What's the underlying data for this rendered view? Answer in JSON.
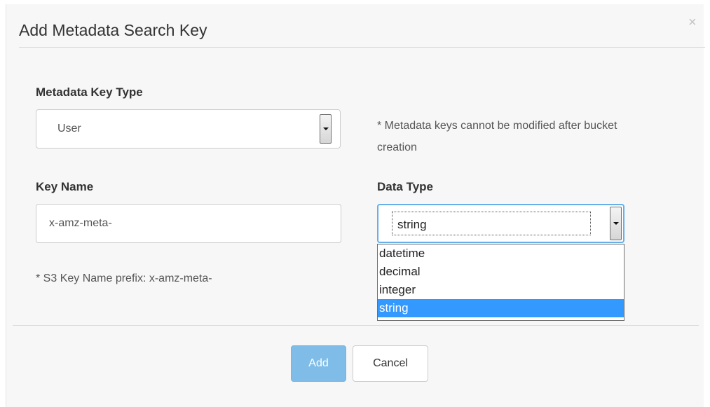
{
  "dialog": {
    "title": "Add Metadata Search Key",
    "close_symbol": "×"
  },
  "metadata_key_type": {
    "label": "Metadata Key Type",
    "selected": "User",
    "note": "* Metadata keys cannot be modified after bucket creation"
  },
  "key_name": {
    "label": "Key Name",
    "value": "x-amz-meta-",
    "prefix_note": "* S3 Key Name prefix: x-amz-meta-"
  },
  "data_type": {
    "label": "Data Type",
    "selected": "string",
    "options": [
      "datetime",
      "decimal",
      "integer",
      "string"
    ],
    "highlighted_option": "string",
    "focus_color": "#66afe9",
    "highlight_color": "#3399ff"
  },
  "footer": {
    "add_label": "Add",
    "cancel_label": "Cancel"
  }
}
